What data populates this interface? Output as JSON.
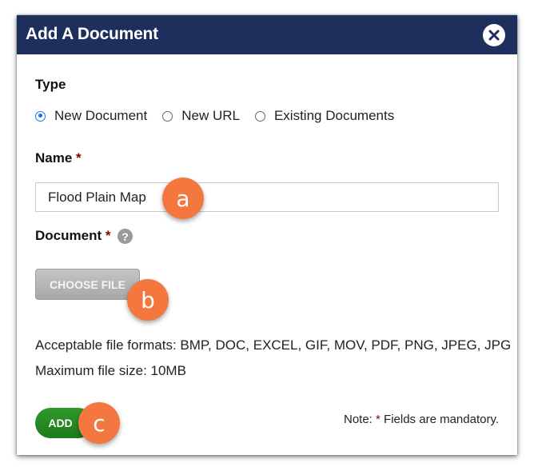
{
  "dialog": {
    "title": "Add A Document",
    "close_icon": "close-icon"
  },
  "type_section": {
    "label": "Type",
    "options": [
      {
        "label": "New Document",
        "selected": true
      },
      {
        "label": "New URL",
        "selected": false
      },
      {
        "label": "Existing Documents",
        "selected": false
      }
    ]
  },
  "name_section": {
    "label": "Name",
    "required_mark": "*",
    "value": "Flood Plain Map"
  },
  "document_section": {
    "label": "Document",
    "required_mark": "*",
    "help_icon": "question-circle-icon",
    "help_glyph": "?",
    "choose_button": "CHOOSE FILE",
    "formats_text": "Acceptable file formats: BMP, DOC, EXCEL, GIF, MOV, PDF, PNG, JPEG, JPG",
    "max_size_text": "Maximum file size: 10MB"
  },
  "footer": {
    "add_button": "ADD",
    "note_prefix": "Note:",
    "note_mark": "*",
    "note_suffix": "Fields are mandatory."
  },
  "callouts": {
    "a": "a",
    "b": "b",
    "c": "c"
  },
  "colors": {
    "titlebar": "#1e2f5e",
    "add_button": "#228b22",
    "callout": "#f4773f",
    "required": "#8b0000",
    "radio_selected": "#1a73e8"
  }
}
